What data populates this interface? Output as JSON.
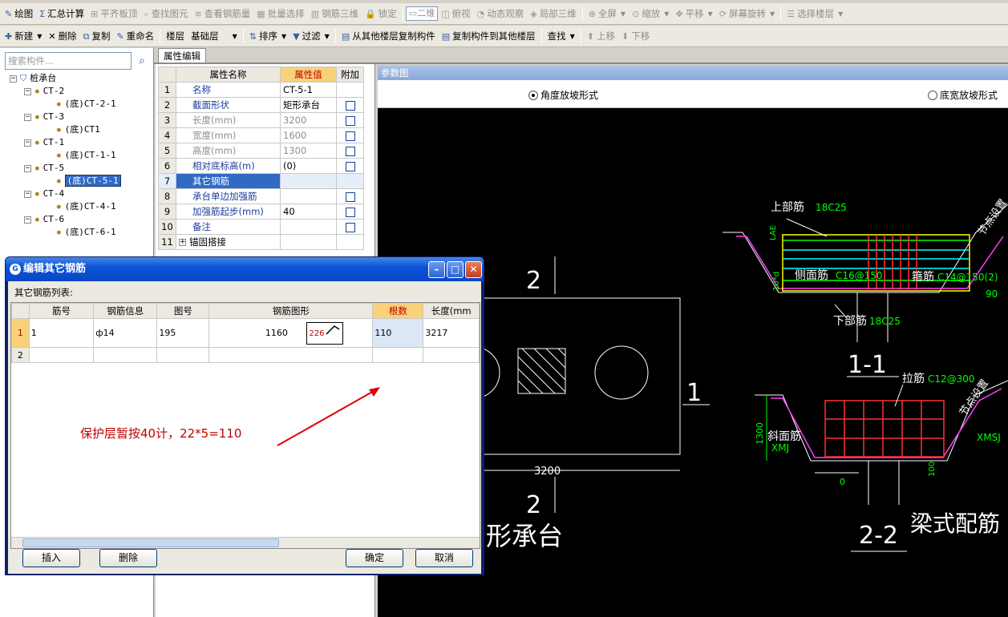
{
  "toolbar1": {
    "items": [
      {
        "label": "绘图",
        "icon": "draw-icon",
        "enabled": true
      },
      {
        "label": "汇总计算",
        "icon": "sigma-icon",
        "enabled": true
      },
      {
        "label": "平齐板顶",
        "icon": "align-slab-icon",
        "enabled": false
      },
      {
        "label": "查找图元",
        "icon": "find-element-icon",
        "enabled": false
      },
      {
        "label": "查看钢筋量",
        "icon": "view-rebar-qty-icon",
        "enabled": false
      },
      {
        "label": "批量选择",
        "icon": "batch-select-icon",
        "enabled": false
      },
      {
        "label": "钢筋三维",
        "icon": "rebar-3d-icon",
        "enabled": false
      },
      {
        "label": "锁定",
        "icon": "lock-icon",
        "enabled": false
      },
      {
        "label": "二维",
        "icon": "view-2d-icon",
        "enabled": false
      },
      {
        "label": "俯视",
        "icon": "top-view-icon",
        "enabled": false
      },
      {
        "label": "动态观察",
        "icon": "orbit-icon",
        "enabled": false
      },
      {
        "label": "局部三维",
        "icon": "local-3d-icon",
        "enabled": false
      },
      {
        "label": "全屏",
        "icon": "fullscreen-icon",
        "enabled": false
      },
      {
        "label": "缩放",
        "icon": "zoom-icon",
        "enabled": false
      },
      {
        "label": "平移",
        "icon": "pan-icon",
        "enabled": false
      },
      {
        "label": "屏幕旋转",
        "icon": "rotate-screen-icon",
        "enabled": false
      },
      {
        "label": "选择楼层",
        "icon": "select-floor-icon",
        "enabled": false
      }
    ]
  },
  "toolbar2": {
    "new_label": "新建",
    "delete_label": "删除",
    "copy_label": "复制",
    "rename_label": "重命名",
    "floor_label": "楼层",
    "floor_value": "基础层",
    "sort_label": "排序",
    "filter_label": "过滤",
    "copy_from_label": "从其他楼层复制构件",
    "copy_to_label": "复制构件到其他楼层",
    "find_label": "查找",
    "up_label": "上移",
    "down_label": "下移"
  },
  "left_panel": {
    "search_placeholder": "搜索构件...",
    "root": "桩承台",
    "groups": [
      {
        "name": "CT-2",
        "child": "(底)CT-2-1"
      },
      {
        "name": "CT-3",
        "child": "(底)CT1"
      },
      {
        "name": "CT-1",
        "child": "(底)CT-1-1"
      },
      {
        "name": "CT-5",
        "child": "(底)CT-5-1"
      },
      {
        "name": "CT-4",
        "child": "(底)CT-4-1"
      },
      {
        "name": "CT-6",
        "child": "(底)CT-6-1"
      }
    ]
  },
  "prop_panel": {
    "tab": "属性编辑",
    "headers": [
      "属性名称",
      "属性值",
      "附加"
    ],
    "rows": [
      {
        "n": "1",
        "name": "名称",
        "value": "CT-5-1"
      },
      {
        "n": "2",
        "name": "截面形状",
        "value": "矩形承台"
      },
      {
        "n": "3",
        "name": "长度(mm)",
        "value": "3200"
      },
      {
        "n": "4",
        "name": "宽度(mm)",
        "value": "1600"
      },
      {
        "n": "5",
        "name": "高度(mm)",
        "value": "1300"
      },
      {
        "n": "6",
        "name": "相对底标高(m)",
        "value": "(0)"
      },
      {
        "n": "7",
        "name": "其它钢筋",
        "value": ""
      },
      {
        "n": "8",
        "name": "承台单边加强筋",
        "value": ""
      },
      {
        "n": "9",
        "name": "加强筋起步(mm)",
        "value": "40"
      },
      {
        "n": "10",
        "name": "备注",
        "value": ""
      },
      {
        "n": "11",
        "name": "锚固搭接",
        "value": ""
      }
    ]
  },
  "param_panel": {
    "title": "参数图",
    "option1": "角度放坡形式",
    "option2": "底宽放坡形式"
  },
  "cad": {
    "sec2_top": "2",
    "sec2_bottom": "2",
    "sec1": "1",
    "dim_3200": "3200",
    "plan_title": "形承台",
    "top_bar_label": "上部筋",
    "top_bar_value": "18C25",
    "lae_label": "LAE",
    "side_bar_label": "侧面筋",
    "side_bar_value": "C16@150",
    "stirrup_label": "箍筋",
    "stirrup_value": "C14@150(2)",
    "bottom_bar_label": "下部筋",
    "bottom_bar_value": "18C25",
    "sec11_title": "1-1",
    "angle_90": "90",
    "lb10d": "10*d",
    "node_label": "节点设置",
    "tie_label": "拉筋",
    "tie_value": "C12@300",
    "slope_label": "斜面筋",
    "xmj": "XMJ",
    "xmsj": "XMSJ",
    "dim_1300": "1300",
    "dim_100": "100",
    "dim_0": "0",
    "sec22_title": "2-2",
    "beam_title": "梁式配筋"
  },
  "dialog": {
    "title": "编辑其它钢筋",
    "list_label": "其它钢筋列表:",
    "headers": [
      "筋号",
      "钢筋信息",
      "图号",
      "钢筋图形",
      "根数",
      "长度(mm"
    ],
    "rows": [
      {
        "n": "1",
        "bar_no": "1",
        "info": "ф14",
        "fig": "195",
        "len_in_shape": "1160",
        "shape_sub": "226",
        "count": "110",
        "length": "3217"
      },
      {
        "n": "2",
        "bar_no": "",
        "info": "",
        "fig": "",
        "len_in_shape": "",
        "shape_sub": "",
        "count": "",
        "length": ""
      }
    ],
    "annotation": "保护层暂按40计，22*5=110",
    "insert_label": "插入",
    "delete_label": "删除",
    "ok_label": "确定",
    "cancel_label": "取消"
  }
}
